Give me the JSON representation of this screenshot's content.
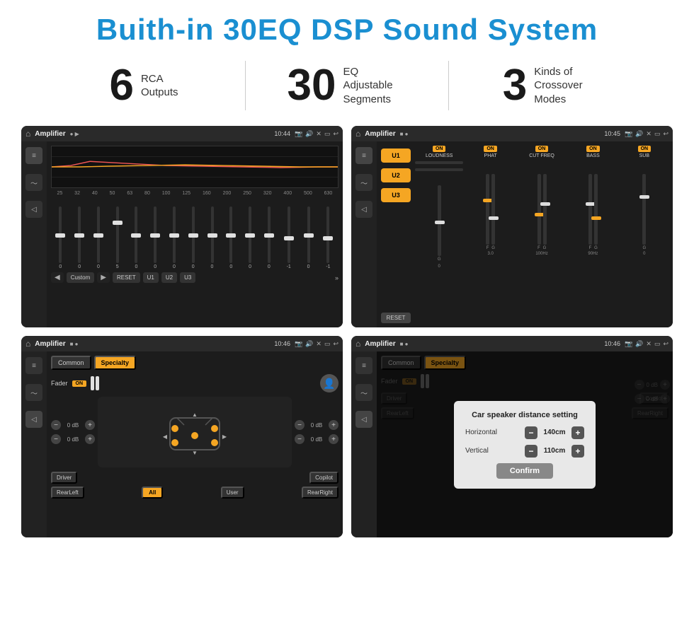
{
  "header": {
    "title": "Buith-in 30EQ DSP Sound System"
  },
  "stats": [
    {
      "number": "6",
      "label": "RCA\nOutputs"
    },
    {
      "number": "30",
      "label": "EQ Adjustable\nSegments"
    },
    {
      "number": "3",
      "label": "Kinds of\nCrossover Modes"
    }
  ],
  "panels": [
    {
      "id": "panel1",
      "title": "Amplifier",
      "time": "10:44",
      "description": "30-Band EQ"
    },
    {
      "id": "panel2",
      "title": "Amplifier",
      "time": "10:45",
      "description": "Crossover Modes"
    },
    {
      "id": "panel3",
      "title": "Amplifier",
      "time": "10:46",
      "description": "Speaker Fader"
    },
    {
      "id": "panel4",
      "title": "Amplifier",
      "time": "10:46",
      "description": "Distance Setting"
    }
  ],
  "eq": {
    "freqs": [
      "25",
      "32",
      "40",
      "50",
      "63",
      "80",
      "100",
      "125",
      "160",
      "200",
      "250",
      "320",
      "400",
      "500",
      "630"
    ],
    "values": [
      "0",
      "0",
      "0",
      "5",
      "0",
      "0",
      "0",
      "0",
      "0",
      "0",
      "0",
      "0",
      "-1",
      "0",
      "-1"
    ],
    "presets": [
      "Custom",
      "RESET",
      "U1",
      "U2",
      "U3"
    ]
  },
  "crossover": {
    "presets": [
      "U1",
      "U2",
      "U3"
    ],
    "channels": [
      "LOUDNESS",
      "PHAT",
      "CUT FREQ",
      "BASS",
      "SUB"
    ],
    "reset": "RESET"
  },
  "speaker": {
    "tabs": [
      "Common",
      "Specialty"
    ],
    "fader_label": "Fader",
    "fader_on": "ON",
    "positions": {
      "driver": "Driver",
      "copilot": "Copilot",
      "rear_left": "RearLeft",
      "rear_right": "RearRight",
      "all": "All",
      "user": "User"
    },
    "volumes": [
      "0 dB",
      "0 dB",
      "0 dB",
      "0 dB"
    ]
  },
  "dialog": {
    "title": "Car speaker distance setting",
    "horizontal_label": "Horizontal",
    "horizontal_value": "140cm",
    "vertical_label": "Vertical",
    "vertical_value": "110cm",
    "confirm_label": "Confirm"
  }
}
